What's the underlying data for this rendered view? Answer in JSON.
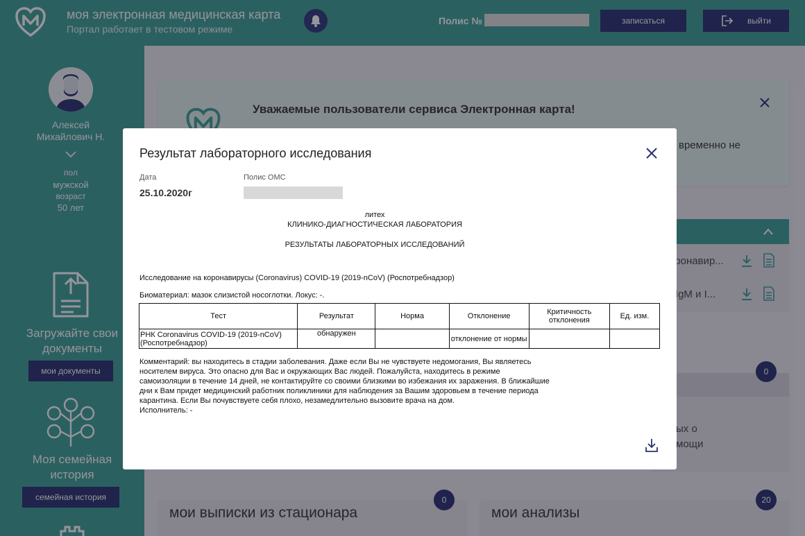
{
  "header": {
    "title": "моя электронная медицинская карта",
    "subtitle": "Портал работает в тестовом режиме",
    "policy_label": "Полис №",
    "book_button": "записаться",
    "exit_button": "выйти"
  },
  "sidebar": {
    "user_name_line1": "Алексей",
    "user_name_line2": "Михайлович Н.",
    "gender_label": "пол",
    "gender_value": "мужской",
    "age_label": "возраст",
    "age_value": "50 лет",
    "docs_text_line1": "Загружайте свои",
    "docs_text_line2": "документы",
    "docs_button": "мои документы",
    "family_text_line1": "Моя семейная",
    "family_text_line2": "история",
    "family_button": "семейная история"
  },
  "main": {
    "notice_title": "Уважаемые пользователи сервиса Электронная карта!",
    "notice_partial": "временно не",
    "list_item1_partial": "оронавир...",
    "list_item2_partial": "л IgM и I...",
    "card_partial_line1": "ых о",
    "card_partial_line2": "мощи",
    "card_count": "0",
    "discharge_title": "мои выписки из стационара",
    "discharge_count": "0",
    "analyses_title": "мои анализы",
    "analyses_count": "20"
  },
  "modal": {
    "title": "Результат лабораторного исследования",
    "date_label": "Дата",
    "date_value": "25.10.2020г",
    "polis_label": "Полис ОМС",
    "doc_line1": "литех",
    "doc_line2": "КЛИНИКО-ДИАГНОСТИЧЕСКАЯ ЛАБОРАТОРИЯ",
    "doc_line3": "РЕЗУЛЬТАТЫ ЛАБОРАТОРНЫХ ИССЛЕДОВАНИЙ",
    "study": "Исследование на коронавирусы (Coronavirus) COVID-19 (2019-nCoV) (Роспотребнадзор)",
    "biomaterial": "Биоматериал: мазок слизистой носоглотки. Локус: -.",
    "table_headers": [
      "Тест",
      "Результат",
      "Норма",
      "Отклонение",
      "Критичность отклонения",
      "Ед. изм."
    ],
    "table_row": [
      "РНК Coronavirus COVID-19 (2019-nCoV) (Роспотребнадзор)",
      "обнаружен",
      "",
      "отклонение от нормы",
      "",
      ""
    ],
    "comment_lines": [
      "Комментарий: вы находитесь в стадии заболевания. Даже если Вы не чувствуете недомогания, Вы являетесь",
      "носителем вируса. Это опасно для Вас и окружающих Вас людей. Пожалуйста, находитесь в режиме",
      "самоизоляции в течение 14 дней, не контактируйте со своими близкими во избежания их заражения. В ближайшие",
      "дни к Вам придет медицинский работник поликлиники для наблюдения за Вашим здоровьем в течение периода",
      "карантина. Если Вы почувствуете себя плохо, незамедлительно вызовите врача на дом."
    ],
    "executor": "Исполнитель: -"
  },
  "colors": {
    "teal": "#3f9e97",
    "navy": "#2b3170"
  }
}
